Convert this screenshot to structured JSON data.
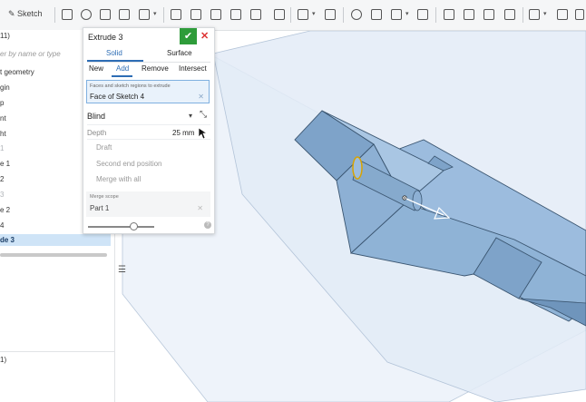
{
  "toolbar": {
    "sketch_label": "Sketch"
  },
  "left_panel": {
    "header": "11)",
    "filter_placeholder": "er by name or type",
    "items": [
      {
        "label": "t geometry",
        "state": "normal"
      },
      {
        "label": "gin",
        "state": "normal"
      },
      {
        "label": "p",
        "state": "normal"
      },
      {
        "label": "nt",
        "state": "normal"
      },
      {
        "label": "ht",
        "state": "normal"
      },
      {
        "label": "1",
        "state": "dim"
      },
      {
        "label": "e 1",
        "state": "normal"
      },
      {
        "label": "2",
        "state": "normal"
      },
      {
        "label": "3",
        "state": "dim"
      },
      {
        "label": "e 2",
        "state": "normal"
      },
      {
        "label": "4",
        "state": "normal"
      },
      {
        "label": "de 3",
        "state": "selected"
      }
    ],
    "footer": "1)"
  },
  "dialog": {
    "title": "Extrude 3",
    "tabs": [
      "Solid",
      "Surface"
    ],
    "operations": [
      "New",
      "Add",
      "Remove",
      "Intersect"
    ],
    "faces_label": "Faces and sketch regions to extrude",
    "faces_value": "Face of Sketch 4",
    "end_type": "Blind",
    "depth_label": "Depth",
    "depth_value": "25 mm",
    "draft_label": "Draft",
    "second_end_label": "Second end position",
    "merge_all_label": "Merge with all",
    "merge_scope_label": "Merge scope",
    "merge_scope_value": "Part 1"
  },
  "colors": {
    "accent": "#2d6db5",
    "ok": "#2e9c3a",
    "cancel": "#dd3333",
    "part_face": "#8fb3d6",
    "plane": "#e6eef8"
  }
}
